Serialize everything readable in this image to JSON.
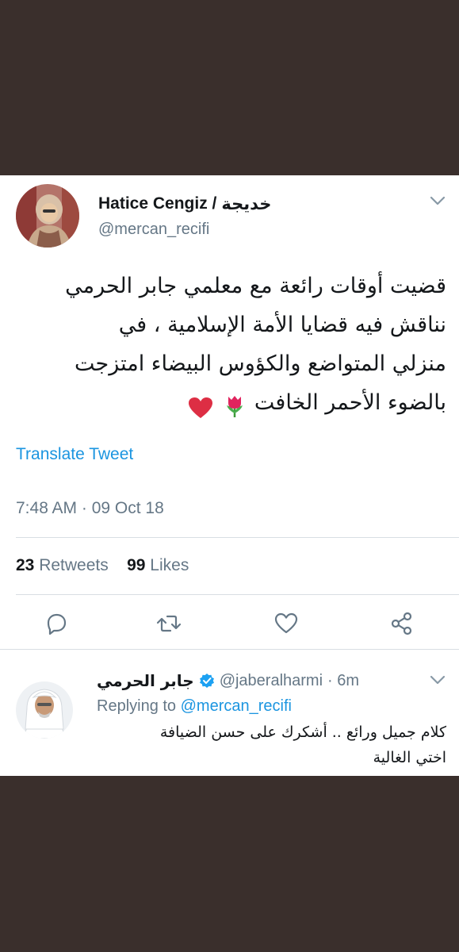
{
  "tweet": {
    "author_name": "Hatice Cengiz /",
    "author_name_ar": "خديجة",
    "handle": "@mercan_recifi",
    "text_lines": [
      "قضيت أوقات رائعة مع معلمي جابر الحرمي",
      "نناقش فيه قضايا الأمة الإسلامية ، في",
      "منزلي المتواضع والكؤوس البيضاء امتزجت",
      "بالضوء الأحمر الخافت"
    ],
    "translate_label": "Translate Tweet",
    "timestamp": "7:48 AM · 09 Oct 18",
    "retweets_count": "23",
    "retweets_label": "Retweets",
    "likes_count": "99",
    "likes_label": "Likes"
  },
  "icons": {
    "reply": "reply-icon",
    "retweet": "retweet-icon",
    "like": "heart-icon",
    "share": "share-icon",
    "more": "chevron-down-icon",
    "verified": "verified-badge-icon"
  },
  "reply": {
    "author_name": "جابر الحرمي",
    "handle": "@jaberalharmi",
    "age": "· 6m",
    "replying_prefix": "Replying to",
    "replying_to": "@mercan_recifi",
    "text_lines": [
      "كلام جميل ورائع .. أشكرك على حسن الضيافة",
      "اختي الغالية"
    ]
  },
  "colors": {
    "background": "#3a2f2c",
    "link": "#1b95e0",
    "muted": "#657786",
    "text": "#14171a",
    "verified": "#1da1f2"
  }
}
